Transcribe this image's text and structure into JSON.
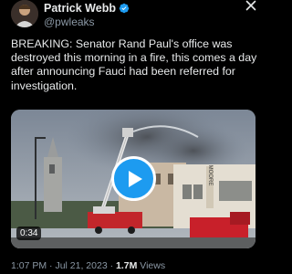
{
  "header": {
    "display_name": "Patrick Webb",
    "handle": "@pwleaks",
    "verified_color": "#1d9bf0"
  },
  "tweet": {
    "text": "BREAKING: Senator Rand Paul's office was destroyed this morning in a fire, this comes a day after announcing Fauci had been referred for investigation."
  },
  "media": {
    "duration": "0:34",
    "sign_text": "MOORE"
  },
  "meta": {
    "time": "1:07 PM",
    "separator_1": "·",
    "date": "Jul 21, 2023",
    "separator_2": "·",
    "views_count": "1.7M",
    "views_label": "Views"
  },
  "icons": {
    "close": "close-icon",
    "verified": "verified-badge-icon",
    "play": "play-icon"
  }
}
